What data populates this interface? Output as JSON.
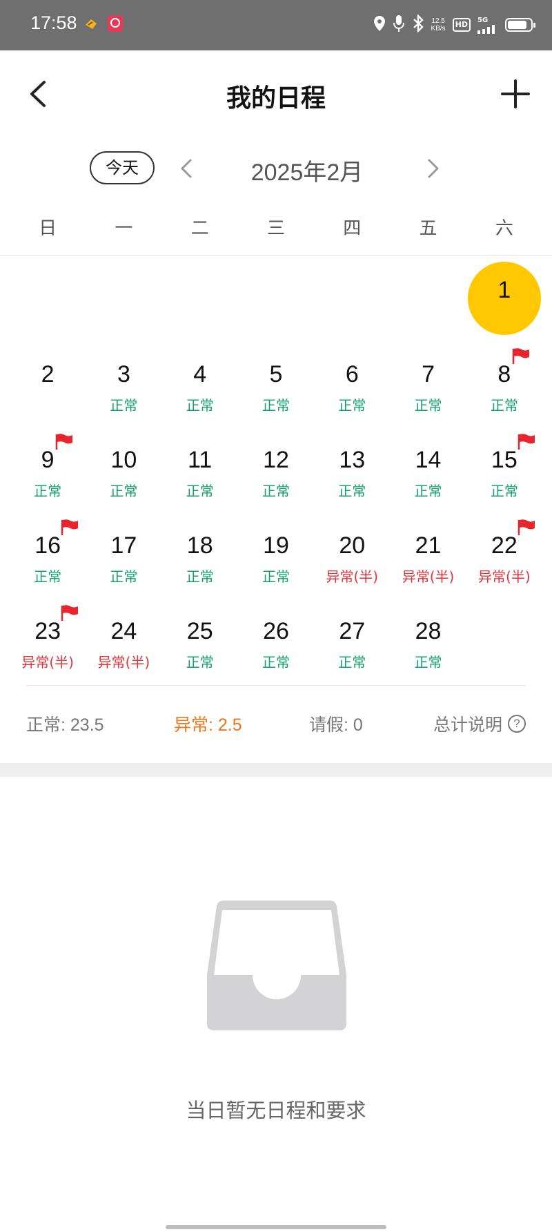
{
  "status_bar": {
    "time": "17:58",
    "net_speed_value": "12.5",
    "net_speed_unit": "KB/s",
    "hd_label": "HD",
    "signal_label": "5G",
    "battery_level": 0.85,
    "icons": [
      "app-notification-icon",
      "app-badge-icon",
      "location-icon",
      "microphone-icon",
      "bluetooth-icon",
      "signal-icon",
      "battery-icon"
    ]
  },
  "header": {
    "title": "我的日程",
    "back_icon": "chevron-left-icon",
    "add_icon": "plus-icon"
  },
  "month_nav": {
    "today_label": "今天",
    "month_title": "2025年2月"
  },
  "weekdays": [
    "日",
    "一",
    "二",
    "三",
    "四",
    "五",
    "六"
  ],
  "calendar": {
    "selected_day": "1",
    "days": [
      {
        "day": "1",
        "status": "",
        "status_type": "",
        "flag": false,
        "selected": true
      },
      {
        "day": "2",
        "status": "",
        "status_type": "",
        "flag": false
      },
      {
        "day": "3",
        "status": "正常",
        "status_type": "normal",
        "flag": false
      },
      {
        "day": "4",
        "status": "正常",
        "status_type": "normal",
        "flag": false
      },
      {
        "day": "5",
        "status": "正常",
        "status_type": "normal",
        "flag": false
      },
      {
        "day": "6",
        "status": "正常",
        "status_type": "normal",
        "flag": false
      },
      {
        "day": "7",
        "status": "正常",
        "status_type": "normal",
        "flag": false
      },
      {
        "day": "8",
        "status": "正常",
        "status_type": "normal",
        "flag": true
      },
      {
        "day": "9",
        "status": "正常",
        "status_type": "normal",
        "flag": true
      },
      {
        "day": "10",
        "status": "正常",
        "status_type": "normal",
        "flag": false
      },
      {
        "day": "11",
        "status": "正常",
        "status_type": "normal",
        "flag": false
      },
      {
        "day": "12",
        "status": "正常",
        "status_type": "normal",
        "flag": false
      },
      {
        "day": "13",
        "status": "正常",
        "status_type": "normal",
        "flag": false
      },
      {
        "day": "14",
        "status": "正常",
        "status_type": "normal",
        "flag": false
      },
      {
        "day": "15",
        "status": "正常",
        "status_type": "normal",
        "flag": true
      },
      {
        "day": "16",
        "status": "正常",
        "status_type": "normal",
        "flag": true
      },
      {
        "day": "17",
        "status": "正常",
        "status_type": "normal",
        "flag": false
      },
      {
        "day": "18",
        "status": "正常",
        "status_type": "normal",
        "flag": false
      },
      {
        "day": "19",
        "status": "正常",
        "status_type": "normal",
        "flag": false
      },
      {
        "day": "20",
        "status": "异常(半)",
        "status_type": "abnormal",
        "flag": false
      },
      {
        "day": "21",
        "status": "异常(半)",
        "status_type": "abnormal",
        "flag": false
      },
      {
        "day": "22",
        "status": "异常(半)",
        "status_type": "abnormal",
        "flag": true
      },
      {
        "day": "23",
        "status": "异常(半)",
        "status_type": "abnormal",
        "flag": true
      },
      {
        "day": "24",
        "status": "异常(半)",
        "status_type": "abnormal",
        "flag": false
      },
      {
        "day": "25",
        "status": "正常",
        "status_type": "normal",
        "flag": false
      },
      {
        "day": "26",
        "status": "正常",
        "status_type": "normal",
        "flag": false
      },
      {
        "day": "27",
        "status": "正常",
        "status_type": "normal",
        "flag": false
      },
      {
        "day": "28",
        "status": "正常",
        "status_type": "normal",
        "flag": false
      }
    ]
  },
  "summary": {
    "normal": "正常: 23.5",
    "abnormal": "异常: 2.5",
    "leave": "请假: 0",
    "explain": "总计说明",
    "help_icon_text": "?"
  },
  "empty_state": {
    "icon": "empty-inbox-icon",
    "text": "当日暂无日程和要求"
  },
  "colors": {
    "normal": "#10a36b",
    "abnormal": "#e2343a",
    "abnormal_summary": "#f07418",
    "selected": "#ffc800",
    "flag": "#e8242c",
    "status_bar": "#6f6f6f"
  }
}
